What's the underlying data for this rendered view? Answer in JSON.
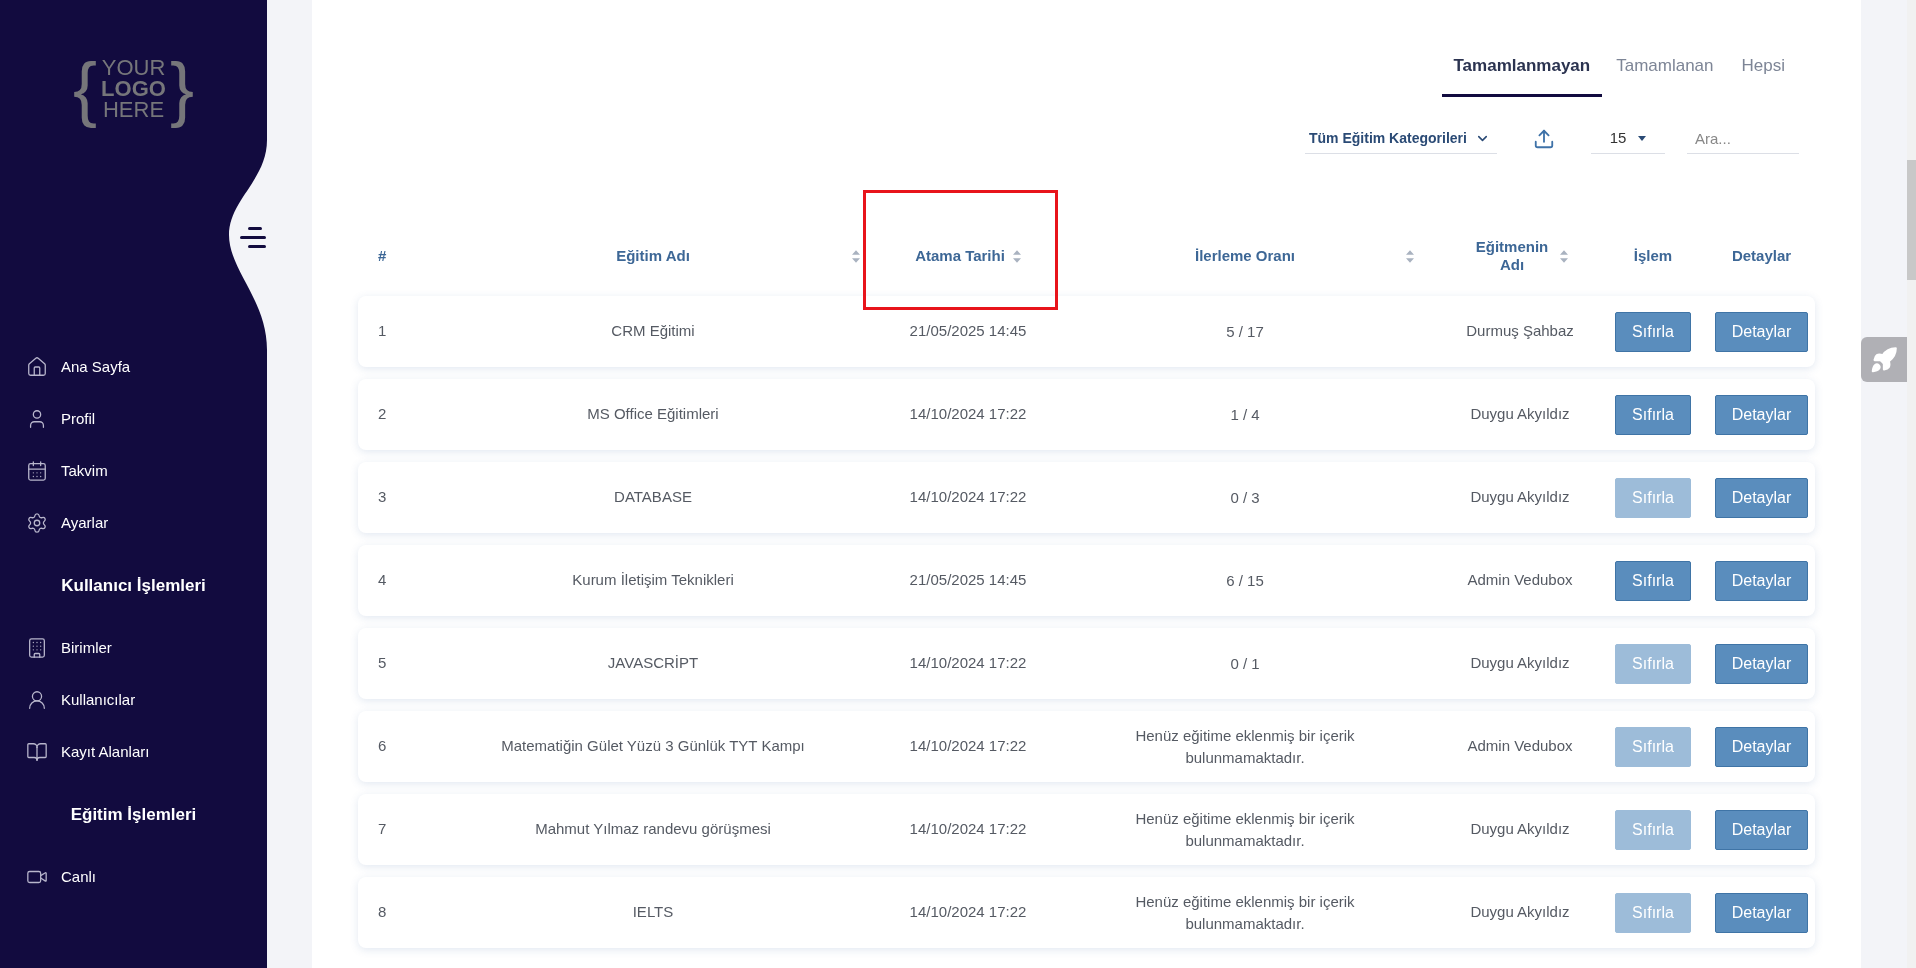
{
  "sidebar": {
    "logo": {
      "brace_open": "{",
      "lines": [
        "YOUR",
        "LOGO",
        "HERE"
      ],
      "brace_close": "}"
    },
    "groups": [
      {
        "items": [
          "Ana Sayfa",
          "Profil",
          "Takvim",
          "Ayarlar"
        ]
      },
      {
        "title": "Kullanıcı İşlemleri",
        "items": [
          "Birimler",
          "Kullanıcılar",
          "Kayıt Alanları"
        ]
      },
      {
        "title": "Eğitim İşlemleri",
        "items": [
          "Canlı"
        ]
      }
    ]
  },
  "tabs": [
    {
      "label": "Tamamlanmayan",
      "selected": true
    },
    {
      "label": "Tamamlanan",
      "selected": false
    },
    {
      "label": "Hepsi",
      "selected": false
    }
  ],
  "toolbar": {
    "category_filter": "Tüm Eğitim Kategorileri",
    "page_size": "15",
    "search": {
      "placeholder": "Ara..."
    }
  },
  "table": {
    "columns": [
      {
        "label": "#",
        "sortable": false,
        "highlighted": false
      },
      {
        "label": "Eğitim Adı",
        "sortable": true,
        "highlighted": false
      },
      {
        "label": "Atama Tarihi",
        "sortable": true,
        "highlighted": true
      },
      {
        "label": "İlerleme Oranı",
        "sortable": true,
        "highlighted": false
      },
      {
        "label": "Eğitmenin Adı",
        "sortable": true,
        "highlighted": false
      },
      {
        "label": "İşlem",
        "sortable": false,
        "highlighted": false
      },
      {
        "label": "Detaylar",
        "sortable": false,
        "highlighted": false
      }
    ],
    "rows": [
      {
        "index": "1",
        "name": "CRM Eğitimi",
        "date": "21/05/2025 14:45",
        "progress": "5 / 17",
        "trainer": "Durmuş Şahbaz",
        "reset": {
          "label": "Sıfırla",
          "disabled": false
        },
        "details": "Detaylar"
      },
      {
        "index": "2",
        "name": "MS Office Eğitimleri",
        "date": "14/10/2024 17:22",
        "progress": "1 / 4",
        "trainer": "Duygu Akyıldız",
        "reset": {
          "label": "Sıfırla",
          "disabled": false
        },
        "details": "Detaylar"
      },
      {
        "index": "3",
        "name": "DATABASE",
        "date": "14/10/2024 17:22",
        "progress": "0 / 3",
        "trainer": "Duygu Akyıldız",
        "reset": {
          "label": "Sıfırla",
          "disabled": true
        },
        "details": "Detaylar"
      },
      {
        "index": "4",
        "name": "Kurum İletişim Teknikleri",
        "date": "21/05/2025 14:45",
        "progress": "6 / 15",
        "trainer": "Admin Vedubox",
        "reset": {
          "label": "Sıfırla",
          "disabled": false
        },
        "details": "Detaylar"
      },
      {
        "index": "5",
        "name": "JAVASCRİPT",
        "date": "14/10/2024 17:22",
        "progress": "0 / 1",
        "trainer": "Duygu Akyıldız",
        "reset": {
          "label": "Sıfırla",
          "disabled": true
        },
        "details": "Detaylar"
      },
      {
        "index": "6",
        "name": "Matematiğin Gület Yüzü 3 Günlük TYT Kampı",
        "date": "14/10/2024 17:22",
        "progress": "Henüz eğitime eklenmiş bir içerik bulunmamaktadır.",
        "trainer": "Admin Vedubox",
        "reset": {
          "label": "Sıfırla",
          "disabled": true
        },
        "details": "Detaylar"
      },
      {
        "index": "7",
        "name": "Mahmut Yılmaz randevu görüşmesi",
        "date": "14/10/2024 17:22",
        "progress": "Henüz eğitime eklenmiş bir içerik bulunmamaktadır.",
        "trainer": "Duygu Akyıldız",
        "reset": {
          "label": "Sıfırla",
          "disabled": true
        },
        "details": "Detaylar"
      },
      {
        "index": "8",
        "name": "IELTS",
        "date": "14/10/2024 17:22",
        "progress": "Henüz eğitime eklenmiş bir içerik bulunmamaktadır.",
        "trainer": "Duygu Akyıldız",
        "reset": {
          "label": "Sıfırla",
          "disabled": true
        },
        "details": "Detaylar"
      }
    ]
  }
}
